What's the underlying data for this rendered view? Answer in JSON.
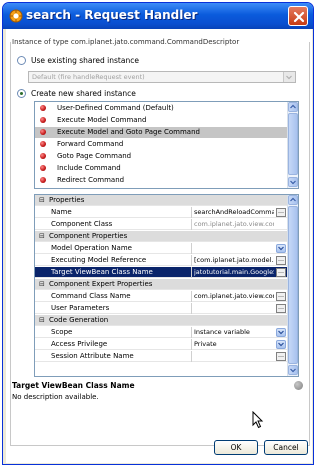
{
  "window": {
    "title": "search - Request Handler",
    "accent": "#0a4fd0"
  },
  "group": {
    "title": "Instance of type com.iplanet.jato.command.CommandDescriptor"
  },
  "options": {
    "use_existing_label": "Use existing shared instance",
    "existing_placeholder": "Default (fire handleRequest event)",
    "create_new_label": "Create new shared instance",
    "selected": "create_new"
  },
  "commands": [
    {
      "label": "User-Defined Command (Default)"
    },
    {
      "label": "Execute Model Command"
    },
    {
      "label": "Execute Model and Goto Page Command"
    },
    {
      "label": "Forward Command"
    },
    {
      "label": "Goto Page Command"
    },
    {
      "label": "Include Command"
    },
    {
      "label": "Redirect Command"
    }
  ],
  "selected_command": "Execute Model and Goto Page Command",
  "properties": {
    "categories": [
      {
        "label": "Properties",
        "rows": [
          {
            "name": "Name",
            "value": "searchAndReloadCommand",
            "editor": "ellipsis"
          },
          {
            "name": "Component Class",
            "value": "com.iplanet.jato.view.comman...",
            "editor": "none"
          }
        ]
      },
      {
        "label": "Component Properties",
        "rows": [
          {
            "name": "Model Operation Name",
            "value": "",
            "editor": "dropdown"
          },
          {
            "name": "Executing Model Reference",
            "value": "[com.iplanet.jato.model.SimpleM",
            "editor": "ellipsis"
          },
          {
            "name": "Target ViewBean Class Name",
            "value": "jatotutorial.main.GoogleSearc...",
            "editor": "ellipsis"
          }
        ]
      },
      {
        "label": "Component Expert Properties",
        "rows": [
          {
            "name": "Command Class Name",
            "value": "com.iplanet.jato.view.comma...",
            "editor": "ellipsis"
          },
          {
            "name": "User Parameters",
            "value": "",
            "editor": "ellipsis"
          }
        ]
      },
      {
        "label": "Code Generation",
        "rows": [
          {
            "name": "Scope",
            "value": "Instance variable",
            "editor": "dropdown"
          },
          {
            "name": "Access Privilege",
            "value": "Private",
            "editor": "dropdown"
          },
          {
            "name": "Session Attribute Name",
            "value": "",
            "editor": "ellipsis"
          }
        ]
      }
    ],
    "selected_row": "Target ViewBean Class Name"
  },
  "description": {
    "title": "Target ViewBean Class Name",
    "text": "No description available."
  },
  "buttons": {
    "ok": "OK",
    "cancel": "Cancel"
  }
}
